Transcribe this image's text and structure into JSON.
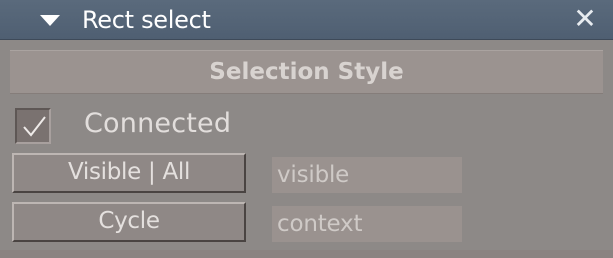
{
  "titlebar": {
    "title": "Rect select",
    "collapse_icon": "triangle-down-icon",
    "close_icon": "close-icon",
    "close_glyph": "✕"
  },
  "section": {
    "title": "Selection Style"
  },
  "connected": {
    "label": "Connected",
    "checked": true
  },
  "buttons": {
    "visible_label": "Visible | All",
    "cycle_label": "Cycle"
  },
  "fields": {
    "visible_value": "visible",
    "context_value": "context"
  },
  "colors": {
    "titlebar": "#53637a",
    "panel": "#8d8987",
    "section_header": "#9b9390",
    "field": "#9a928f"
  }
}
